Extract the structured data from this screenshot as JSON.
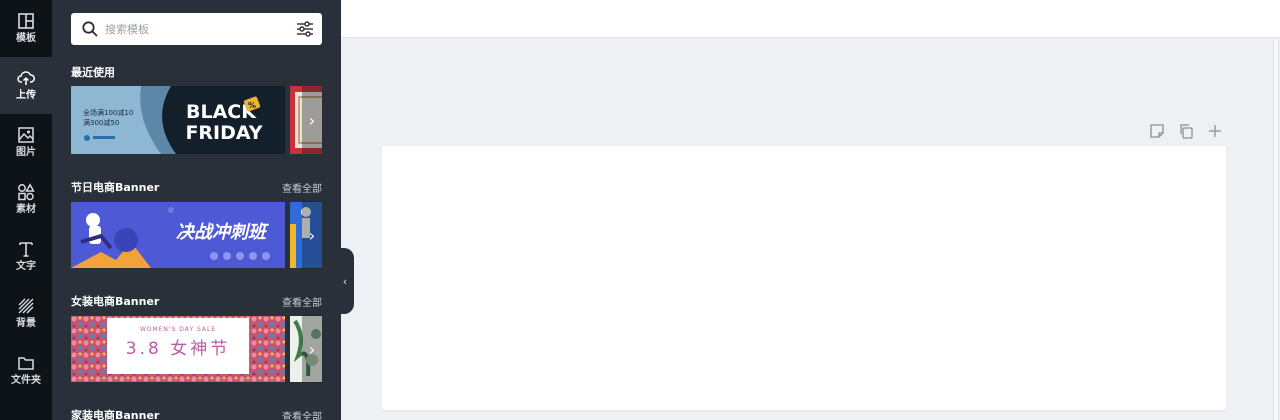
{
  "rail": {
    "items": [
      {
        "label": "模板",
        "icon": "template-icon"
      },
      {
        "label": "上传",
        "icon": "upload-cloud-icon"
      },
      {
        "label": "图片",
        "icon": "image-icon"
      },
      {
        "label": "素材",
        "icon": "shapes-icon"
      },
      {
        "label": "文字",
        "icon": "text-icon"
      },
      {
        "label": "背景",
        "icon": "background-hatch-icon"
      },
      {
        "label": "文件夹",
        "icon": "folder-icon"
      }
    ]
  },
  "search": {
    "placeholder": "搜索模板",
    "icon": "search-icon",
    "filter_icon": "filter-sliders-icon"
  },
  "sections": {
    "recent": {
      "title": "最近使用"
    },
    "festival": {
      "title": "节日电商Banner",
      "more": "查看全部"
    },
    "women": {
      "title": "女装电商Banner",
      "more": "查看全部"
    },
    "home": {
      "title": "家装电商Banner",
      "more": "查看全部"
    }
  },
  "thumbs": {
    "blackfriday": {
      "promo1": "全场满100减10",
      "promo2": "满300减50",
      "line1": "BLACK",
      "line2": "FRIDAY",
      "badge": "%"
    },
    "sprint": {
      "text": "决战冲刺班"
    },
    "womensday": {
      "small": "WOMEN'S DAY SALE",
      "big": "3.8 女神节"
    }
  },
  "canvas_tools": [
    "note-icon",
    "duplicate-icon",
    "add-icon"
  ],
  "colors": {
    "rail": "#0e1318",
    "panel": "#293039",
    "workspace": "#eef0f3",
    "canvas": "#ffffff"
  }
}
